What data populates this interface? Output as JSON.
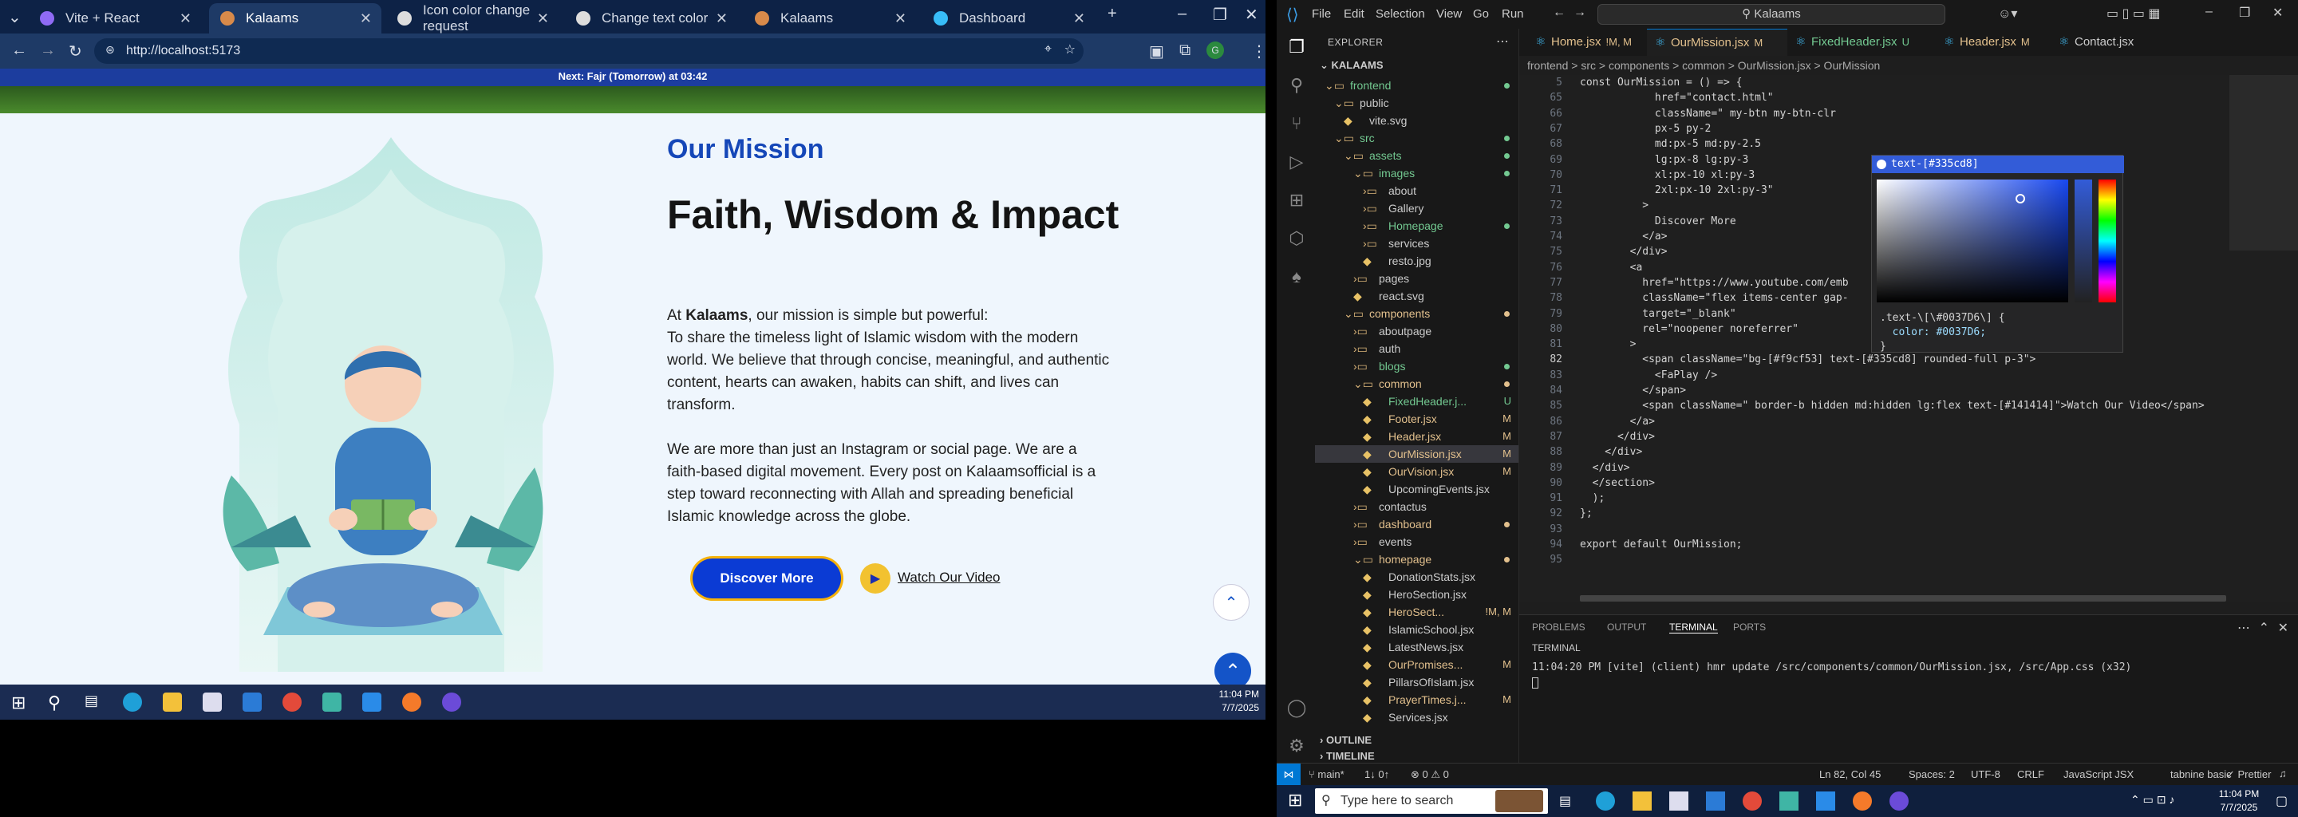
{
  "browser": {
    "tabs": [
      {
        "label": "Vite + React",
        "active": false,
        "favicon_color": "#8f6bf5"
      },
      {
        "label": "Kalaams",
        "active": true,
        "favicon_color": "#d88a4a"
      },
      {
        "label": "Icon color change request",
        "active": false,
        "favicon_color": "#dddddd"
      },
      {
        "label": "Change text color",
        "active": false,
        "favicon_color": "#dddddd"
      },
      {
        "label": "Kalaams",
        "active": false,
        "favicon_color": "#d88a4a"
      },
      {
        "label": "Dashboard",
        "active": false,
        "favicon_color": "#38bdf8"
      }
    ],
    "url": "http://localhost:5173"
  },
  "page": {
    "prayer_banner": "Next: Fajr (Tomorrow) at 03:42",
    "mission_label": "Our Mission",
    "mission_title": "Faith, Wisdom & Impact",
    "para1_intro": "At ",
    "para1_brand": "Kalaams",
    "para1_rest": ", our mission is simple but powerful:",
    "para1_body": "To share the timeless light of Islamic wisdom with the modern world. We believe that through concise, meaningful, and authentic content, hearts can awaken, habits can shift, and lives can transform.",
    "para2": "We are more than just an Instagram or social page. We are a faith-based digital movement. Every post on Kalaamsofficial is a step toward reconnecting with Allah and spreading beneficial Islamic knowledge across the globe.",
    "discover_btn": "Discover More",
    "watch_link": "Watch Our Video",
    "accent_color": "#1547b8"
  },
  "taskbar_left": {
    "time": "11:04 PM",
    "date": "7/7/2025"
  },
  "vscode": {
    "menu": [
      "File",
      "Edit",
      "Selection",
      "View",
      "Go",
      "Run"
    ],
    "search": "Kalaams",
    "explorer_title": "EXPLORER",
    "root": "KALAAMS",
    "tree": [
      {
        "label": "frontend",
        "depth": 1,
        "kind": "folder-open",
        "color": "#73c991",
        "dot": "#73c991"
      },
      {
        "label": "public",
        "depth": 2,
        "kind": "folder-open",
        "color": "#ccc",
        "dot": ""
      },
      {
        "label": "vite.svg",
        "depth": 3,
        "kind": "file",
        "color": "#ccc",
        "dot": ""
      },
      {
        "label": "src",
        "depth": 2,
        "kind": "folder-open",
        "color": "#73c991",
        "dot": "#73c991"
      },
      {
        "label": "assets",
        "depth": 3,
        "kind": "folder-open",
        "color": "#73c991",
        "dot": "#73c991"
      },
      {
        "label": "images",
        "depth": 4,
        "kind": "folder-open",
        "color": "#73c991",
        "dot": "#73c991"
      },
      {
        "label": "about",
        "depth": 5,
        "kind": "folder",
        "color": "#ccc",
        "dot": ""
      },
      {
        "label": "Gallery",
        "depth": 5,
        "kind": "folder",
        "color": "#ccc",
        "dot": ""
      },
      {
        "label": "Homepage",
        "depth": 5,
        "kind": "folder",
        "color": "#73c991",
        "dot": "#73c991"
      },
      {
        "label": "services",
        "depth": 5,
        "kind": "folder",
        "color": "#ccc",
        "dot": ""
      },
      {
        "label": "resto.jpg",
        "depth": 5,
        "kind": "file",
        "color": "#ccc",
        "dot": ""
      },
      {
        "label": "pages",
        "depth": 4,
        "kind": "folder",
        "color": "#ccc",
        "dot": ""
      },
      {
        "label": "react.svg",
        "depth": 4,
        "kind": "file",
        "color": "#ccc",
        "dot": ""
      },
      {
        "label": "components",
        "depth": 3,
        "kind": "folder-open",
        "color": "#e2c08d",
        "dot": "#e2c08d"
      },
      {
        "label": "aboutpage",
        "depth": 4,
        "kind": "folder",
        "color": "#ccc",
        "dot": ""
      },
      {
        "label": "auth",
        "depth": 4,
        "kind": "folder",
        "color": "#ccc",
        "dot": ""
      },
      {
        "label": "blogs",
        "depth": 4,
        "kind": "folder",
        "color": "#73c991",
        "dot": "#73c991"
      },
      {
        "label": "common",
        "depth": 4,
        "kind": "folder-open",
        "color": "#e2c08d",
        "dot": "#e2c08d"
      },
      {
        "label": "FixedHeader.j...",
        "depth": 5,
        "kind": "file",
        "color": "#73c991",
        "mark": "U"
      },
      {
        "label": "Footer.jsx",
        "depth": 5,
        "kind": "file",
        "color": "#e2c08d",
        "mark": "M"
      },
      {
        "label": "Header.jsx",
        "depth": 5,
        "kind": "file",
        "color": "#e2c08d",
        "mark": "M"
      },
      {
        "label": "OurMission.jsx",
        "depth": 5,
        "kind": "file",
        "color": "#e2c08d",
        "mark": "M",
        "selected": true
      },
      {
        "label": "OurVision.jsx",
        "depth": 5,
        "kind": "file",
        "color": "#e2c08d",
        "mark": "M"
      },
      {
        "label": "UpcomingEvents.jsx",
        "depth": 5,
        "kind": "file",
        "color": "#ccc",
        "dot": ""
      },
      {
        "label": "contactus",
        "depth": 4,
        "kind": "folder",
        "color": "#ccc",
        "dot": ""
      },
      {
        "label": "dashboard",
        "depth": 4,
        "kind": "folder",
        "color": "#e2c08d",
        "dot": "#e2c08d"
      },
      {
        "label": "events",
        "depth": 4,
        "kind": "folder",
        "color": "#ccc",
        "dot": ""
      },
      {
        "label": "homepage",
        "depth": 4,
        "kind": "folder-open",
        "color": "#e2c08d",
        "dot": "#e2c08d"
      },
      {
        "label": "DonationStats.jsx",
        "depth": 5,
        "kind": "file",
        "color": "#ccc",
        "dot": ""
      },
      {
        "label": "HeroSection.jsx",
        "depth": 5,
        "kind": "file",
        "color": "#ccc",
        "dot": ""
      },
      {
        "label": "HeroSect...",
        "depth": 5,
        "kind": "file",
        "color": "#e2c08d",
        "mark": "!M, M"
      },
      {
        "label": "IslamicSchool.jsx",
        "depth": 5,
        "kind": "file",
        "color": "#ccc",
        "dot": ""
      },
      {
        "label": "LatestNews.jsx",
        "depth": 5,
        "kind": "file",
        "color": "#ccc",
        "dot": ""
      },
      {
        "label": "OurPromises...",
        "depth": 5,
        "kind": "file",
        "color": "#e2c08d",
        "mark": "M"
      },
      {
        "label": "PillarsOfIslam.jsx",
        "depth": 5,
        "kind": "file",
        "color": "#ccc",
        "dot": ""
      },
      {
        "label": "PrayerTimes.j...",
        "depth": 5,
        "kind": "file",
        "color": "#e2c08d",
        "mark": "M"
      },
      {
        "label": "Services.jsx",
        "depth": 5,
        "kind": "file",
        "color": "#ccc",
        "dot": ""
      }
    ],
    "outline": "OUTLINE",
    "timeline": "TIMELINE",
    "editor_tabs": [
      {
        "label": "Home.jsx",
        "mark": "!M, M",
        "color": "#e2c08d",
        "active": false
      },
      {
        "label": "OurMission.jsx",
        "mark": "M",
        "color": "#e2c08d",
        "active": true
      },
      {
        "label": "FixedHeader.jsx",
        "mark": "U",
        "color": "#73c991",
        "active": false
      },
      {
        "label": "Header.jsx",
        "mark": "M",
        "color": "#e2c08d",
        "active": false
      },
      {
        "label": "Contact.jsx",
        "mark": "",
        "color": "#ccc",
        "active": false
      }
    ],
    "breadcrumb": "frontend > src > components > common > OurMission.jsx > OurMission",
    "code": [
      {
        "n": "5",
        "t": "const OurMission = () => {"
      },
      {
        "n": "65",
        "t": "            href=\"contact.html\""
      },
      {
        "n": "66",
        "t": "            className=\" my-btn my-btn-clr"
      },
      {
        "n": "67",
        "t": "            px-5 py-2"
      },
      {
        "n": "68",
        "t": "            md:px-5 md:py-2.5"
      },
      {
        "n": "69",
        "t": "            lg:px-8 lg:py-3"
      },
      {
        "n": "70",
        "t": "            xl:px-10 xl:py-3"
      },
      {
        "n": "71",
        "t": "            2xl:px-10 2xl:py-3\""
      },
      {
        "n": "72",
        "t": "          >"
      },
      {
        "n": "73",
        "t": "            Discover More"
      },
      {
        "n": "74",
        "t": "          </a>"
      },
      {
        "n": "75",
        "t": "        </div>"
      },
      {
        "n": "76",
        "t": "        <a"
      },
      {
        "n": "77",
        "t": "          href=\"https://www.youtube.com/emb"
      },
      {
        "n": "78",
        "t": "          className=\"flex items-center gap-"
      },
      {
        "n": "79",
        "t": "          target=\"_blank\""
      },
      {
        "n": "80",
        "t": "          rel=\"noopener noreferrer\""
      },
      {
        "n": "81",
        "t": "        >"
      },
      {
        "n": "82",
        "t": "          <span className=\"bg-[#f9cf53] text-[#335cd8] rounded-full p-3\">"
      },
      {
        "n": "83",
        "t": "            <FaPlay />"
      },
      {
        "n": "84",
        "t": "          </span>"
      },
      {
        "n": "85",
        "t": "          <span className=\" border-b hidden md:hidden lg:flex text-[#141414]\">Watch Our Video</span>"
      },
      {
        "n": "86",
        "t": "        </a>"
      },
      {
        "n": "87",
        "t": "      </div>"
      },
      {
        "n": "88",
        "t": "    </div>"
      },
      {
        "n": "89",
        "t": "  </div>"
      },
      {
        "n": "90",
        "t": "  </section>"
      },
      {
        "n": "91",
        "t": "  );"
      },
      {
        "n": "92",
        "t": "};"
      },
      {
        "n": "93",
        "t": ""
      },
      {
        "n": "94",
        "t": "export default OurMission;"
      },
      {
        "n": "95",
        "t": ""
      }
    ],
    "picker": {
      "title": "text-[#335cd8]",
      "css1": ".text-\\[\\#0037D6\\] {",
      "css2": "  color: #0037D6;",
      "css3": "}"
    },
    "panel_tabs": [
      "PROBLEMS",
      "OUTPUT",
      "TERMINAL",
      "PORTS"
    ],
    "terminal_label": "TERMINAL",
    "terminal_line": "11:04:20 PM [vite] (client) hmr update /src/components/common/OurMission.jsx, /src/App.css (x32)",
    "status": {
      "branch": "main*",
      "sync": "1↓ 0↑",
      "problems": "⊗ 0 ⚠ 0",
      "position": "Ln 82, Col 45",
      "spaces": "Spaces: 2",
      "encoding": "UTF-8",
      "eol": "CRLF",
      "language": "JavaScript JSX",
      "tabnine": "tabnine basic",
      "prettier": "✓ Prettier"
    }
  },
  "taskbar_right": {
    "search_placeholder": "Type here to search",
    "time": "11:04 PM",
    "date": "7/7/2025"
  }
}
